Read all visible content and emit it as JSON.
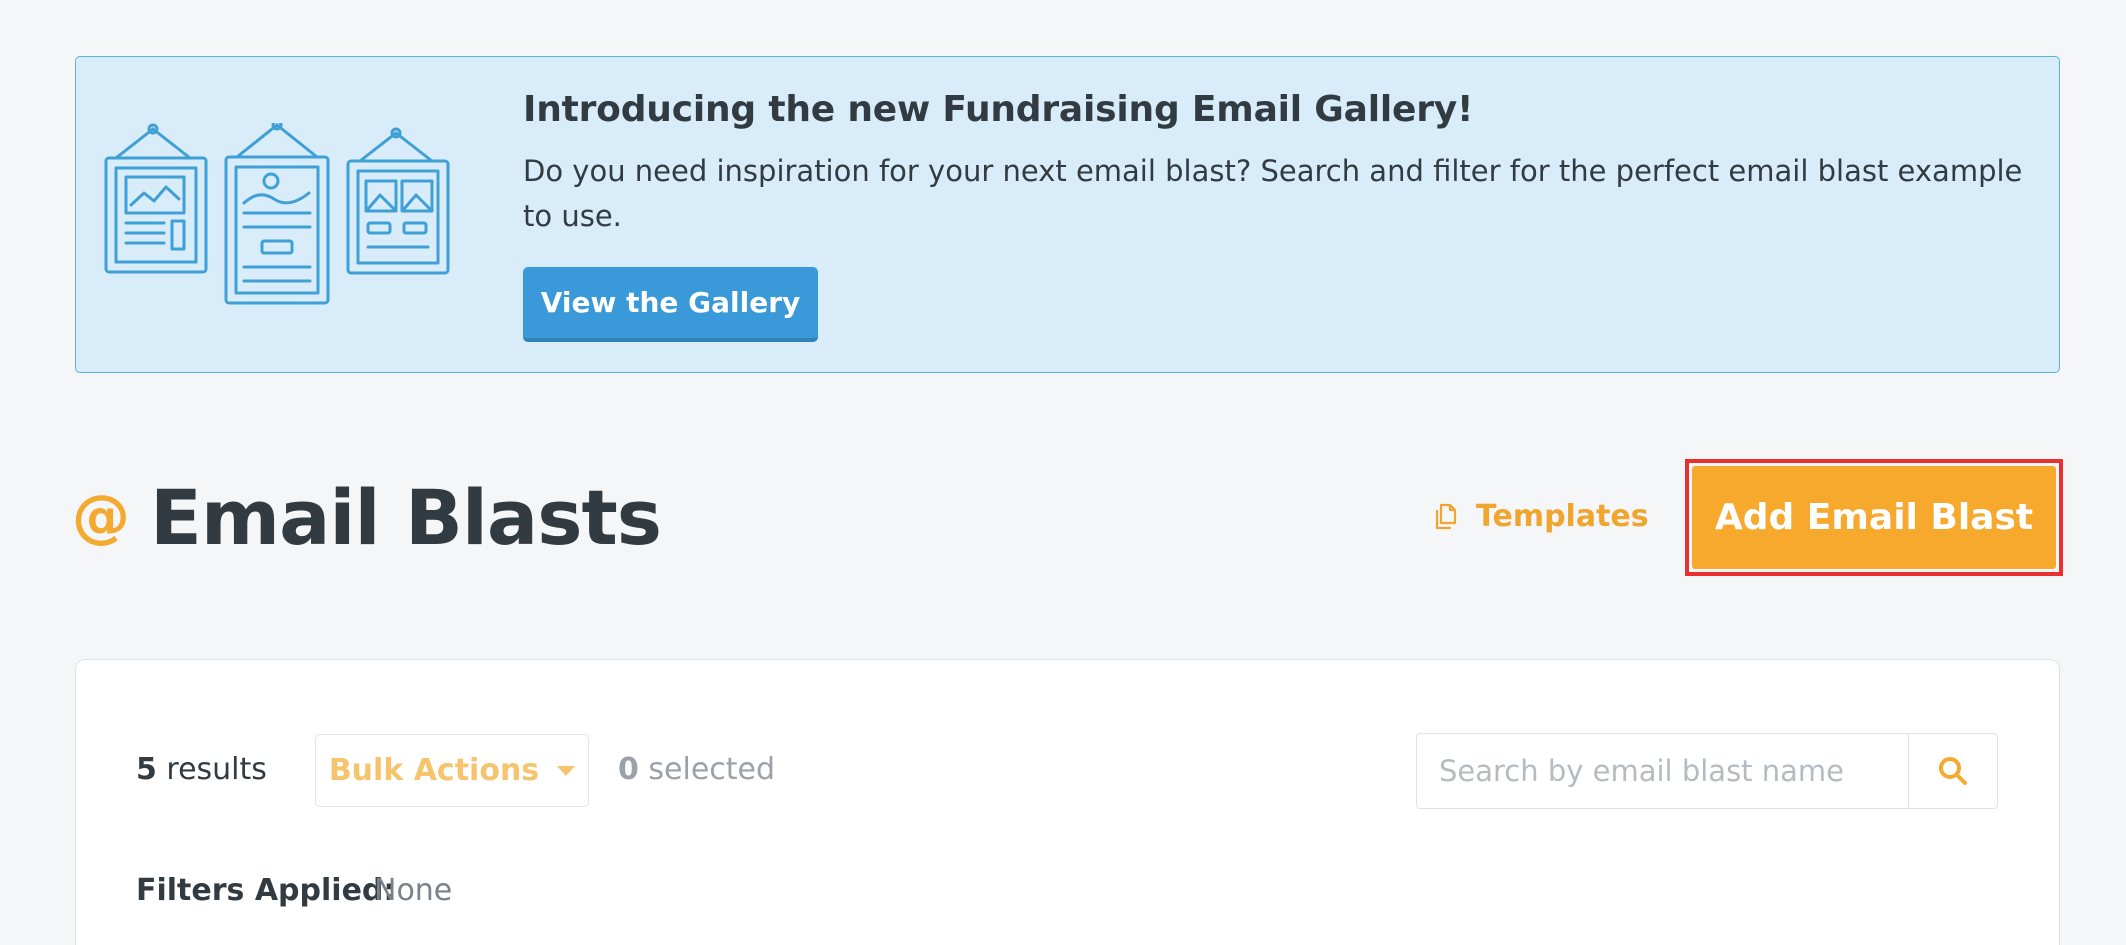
{
  "banner": {
    "title": "Introducing the new Fundraising Email Gallery!",
    "text": "Do you need inspiration for your next email blast? Search and filter for the perfect email blast example to use.",
    "button_label": "View the Gallery",
    "illustration_icon": "framed-email-templates-illustration"
  },
  "header": {
    "icon": "at-sign-icon",
    "icon_glyph": "@",
    "title": "Email Blasts",
    "templates_label": "Templates",
    "templates_icon": "copy-icon",
    "add_button_label": "Add Email Blast"
  },
  "results": {
    "count": "5",
    "count_suffix": " results",
    "bulk_actions_label": "Bulk Actions",
    "selected_count": "0",
    "selected_suffix": " selected",
    "search_placeholder": "Search by email blast name",
    "search_icon": "search-icon",
    "filters_label": "Filters Applied:",
    "filters_value": "None"
  },
  "colors": {
    "accent": "#f6a92d",
    "banner_bg": "#d8edf9",
    "banner_border": "#5db3db",
    "primary_button": "#3a9ad9",
    "highlight_outline": "#e8302e",
    "text": "#333b42"
  }
}
